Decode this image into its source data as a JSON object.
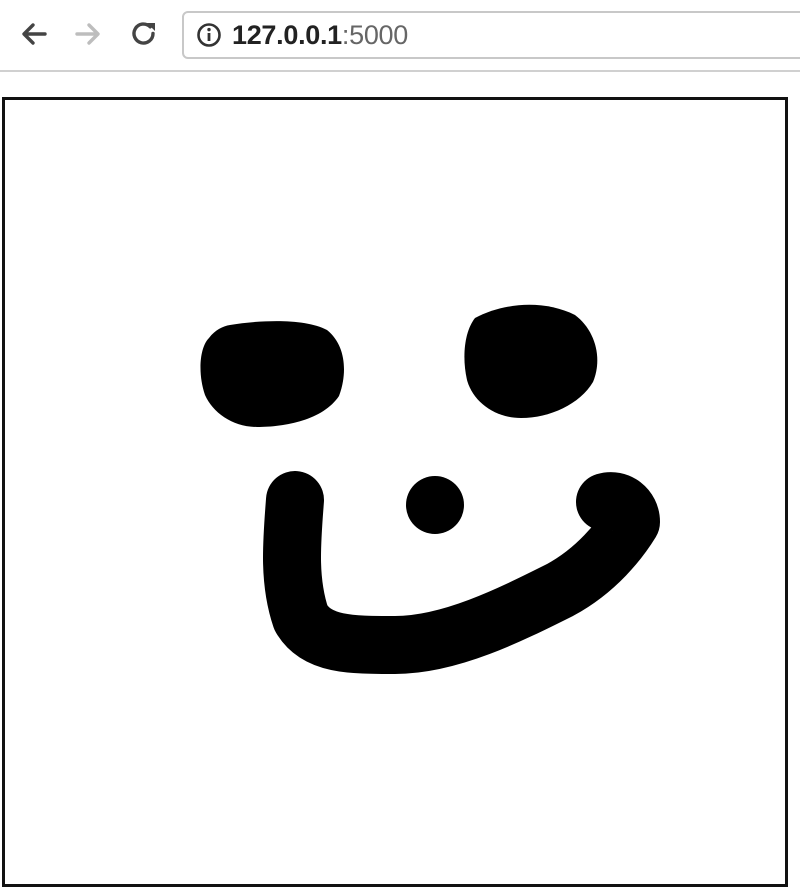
{
  "browser": {
    "url_host": "127.0.0.1",
    "url_port": ":5000",
    "icons": {
      "back": "arrow-left-icon",
      "forward": "arrow-right-icon",
      "reload": "reload-icon",
      "info": "info-icon"
    }
  },
  "canvas": {
    "background": "#ffffff",
    "stroke_color": "#000000",
    "border_color": "#111111"
  }
}
